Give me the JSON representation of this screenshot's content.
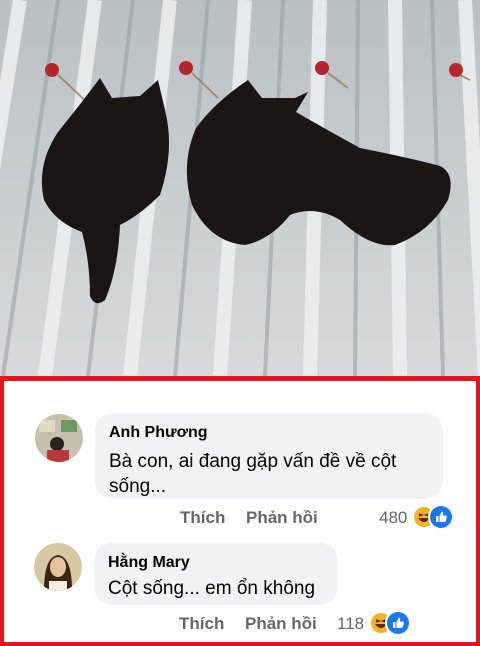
{
  "post_image": {
    "description_icon": "two-black-cats-on-roof-photo"
  },
  "comments": [
    {
      "author": "Anh Phương",
      "text_line1": "Bà con, ai đang gặp vấn đề về cột",
      "text_line2": "sống...",
      "like_label": "Thích",
      "reply_label": "Phản hồi",
      "reaction_count": "480",
      "reactions": [
        "haha-icon",
        "like-icon"
      ]
    },
    {
      "author": "Hằng Mary",
      "text_line1": "Cột sống... em ổn không",
      "like_label": "Thích",
      "reply_label": "Phản hồi",
      "reaction_count": "118",
      "reactions": [
        "haha-icon",
        "like-icon"
      ]
    }
  ],
  "colors": {
    "highlight_border": "#e8141c",
    "bubble_bg": "#f0f2f5",
    "meta_text": "#65676b",
    "like_blue": "#1877f2",
    "haha_yellow": "#f7b125"
  }
}
